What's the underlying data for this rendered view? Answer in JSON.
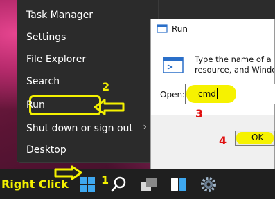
{
  "context_menu": {
    "items": [
      {
        "label": "Task Manager"
      },
      {
        "label": "Settings"
      },
      {
        "label": "File Explorer"
      },
      {
        "label": "Search"
      },
      {
        "label": "Run"
      },
      {
        "label": "Shut down or sign out"
      },
      {
        "label": "Desktop"
      }
    ],
    "submenu_arrow": "›"
  },
  "run_dialog": {
    "title": "Run",
    "description_line1": "Type the name of a p",
    "description_line2": "resource, and Window",
    "open_label": "Open:",
    "open_value": "cmd",
    "ok_label": "OK"
  },
  "annotations": {
    "step1": "1",
    "step2": "2",
    "step3": "3",
    "step4": "4",
    "right_click": "Right Click"
  },
  "colors": {
    "highlight": "#f4f100",
    "step_red": "#e01010",
    "step_yellow": "#f4f100"
  },
  "taskbar": {
    "icons": [
      "windows-start-icon",
      "search-icon",
      "task-view-icon",
      "widgets-icon",
      "settings-gear-icon"
    ]
  }
}
